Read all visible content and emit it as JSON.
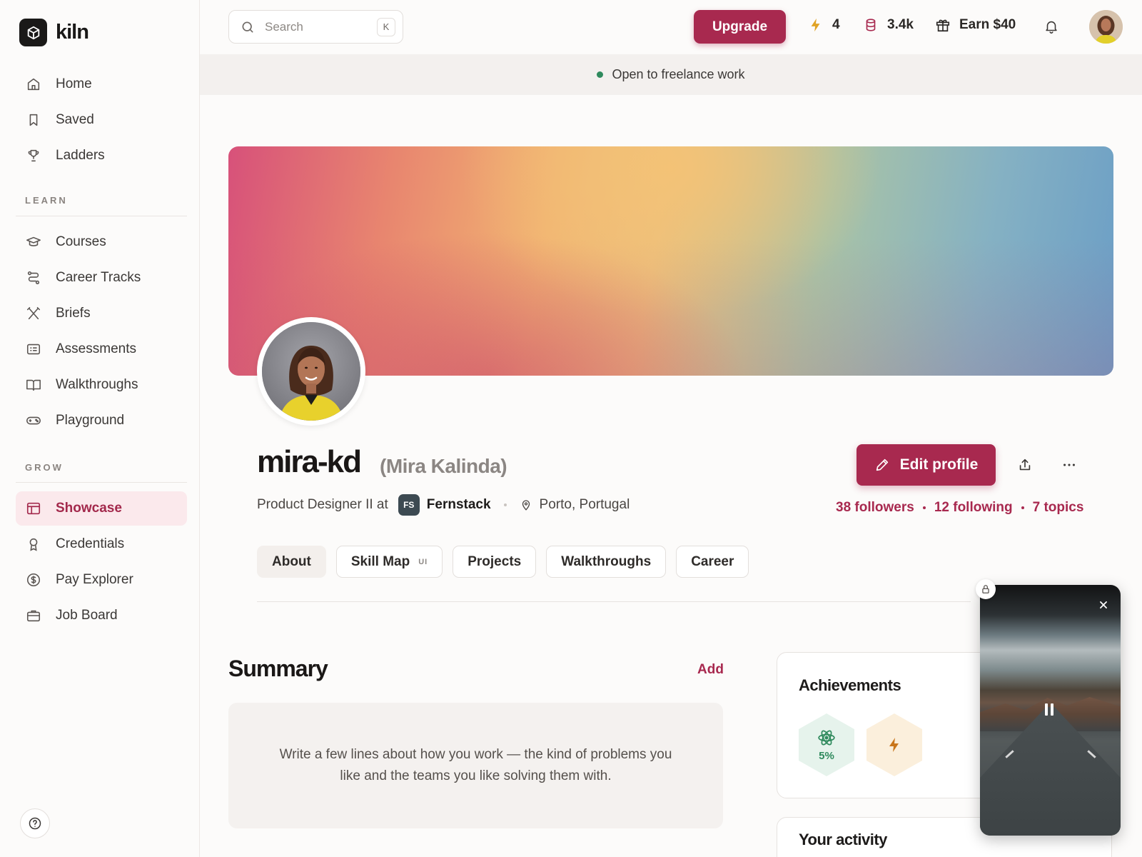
{
  "app": {
    "name": "kiln"
  },
  "sidebar": {
    "main_items": [
      {
        "label": "Home",
        "icon": "home-icon"
      },
      {
        "label": "Saved",
        "icon": "bookmark-icon"
      },
      {
        "label": "Ladders",
        "icon": "trophy-icon"
      }
    ],
    "learn_section": "LEARN",
    "learn_items": [
      {
        "label": "Courses",
        "icon": "graduation-cap-icon"
      },
      {
        "label": "Career Tracks",
        "icon": "route-icon"
      },
      {
        "label": "Briefs",
        "icon": "crossed-tools-icon"
      },
      {
        "label": "Assessments",
        "icon": "checklist-icon"
      },
      {
        "label": "Walkthroughs",
        "icon": "book-open-icon"
      },
      {
        "label": "Playground",
        "icon": "gamepad-icon"
      }
    ],
    "grow_section": "GROW",
    "grow_items": [
      {
        "label": "Showcase",
        "icon": "layout-icon",
        "active": true
      },
      {
        "label": "Credentials",
        "icon": "award-icon"
      },
      {
        "label": "Pay Explorer",
        "icon": "dollar-circle-icon"
      },
      {
        "label": "Job Board",
        "icon": "briefcase-icon"
      }
    ]
  },
  "topbar": {
    "search_placeholder": "Search",
    "search_shortcut": "K",
    "upgrade_label": "Upgrade",
    "streak": "4",
    "credits": "3.4k",
    "earn_label": "Earn $40"
  },
  "status_banner": {
    "text": "Open to freelance work"
  },
  "profile": {
    "handle": "mira-kd",
    "full_name": "(Mira Kalinda)",
    "role_prefix": "Product Designer II at",
    "company_initials": "FS",
    "company": "Fernstack",
    "location": "Porto, Portugal",
    "edit_label": "Edit profile",
    "followers": "38 followers",
    "following": "12 following",
    "topics": "7 topics"
  },
  "tabs": [
    {
      "label": "About",
      "active": true,
      "badge": ""
    },
    {
      "label": "Skill Map",
      "active": false,
      "badge": "UI"
    },
    {
      "label": "Projects",
      "active": false,
      "badge": ""
    },
    {
      "label": "Walkthroughs",
      "active": false,
      "badge": ""
    },
    {
      "label": "Career",
      "active": false,
      "badge": ""
    }
  ],
  "summary": {
    "title": "Summary",
    "add_label": "Add",
    "placeholder": "Write a few lines about how you work — the kind of problems you like and the teams you like solving them with."
  },
  "achievements": {
    "title": "Achievements",
    "badges": [
      {
        "icon": "atom-icon",
        "value": "5%",
        "color": "#2f8a5d"
      },
      {
        "icon": "bolt-icon",
        "value": "",
        "color": "#c9761c"
      }
    ]
  },
  "activity": {
    "title": "Your activity"
  },
  "colors": {
    "accent": "#a8294f",
    "accent_soft": "#fbe9ec",
    "status_green": "#2f8a5d"
  }
}
